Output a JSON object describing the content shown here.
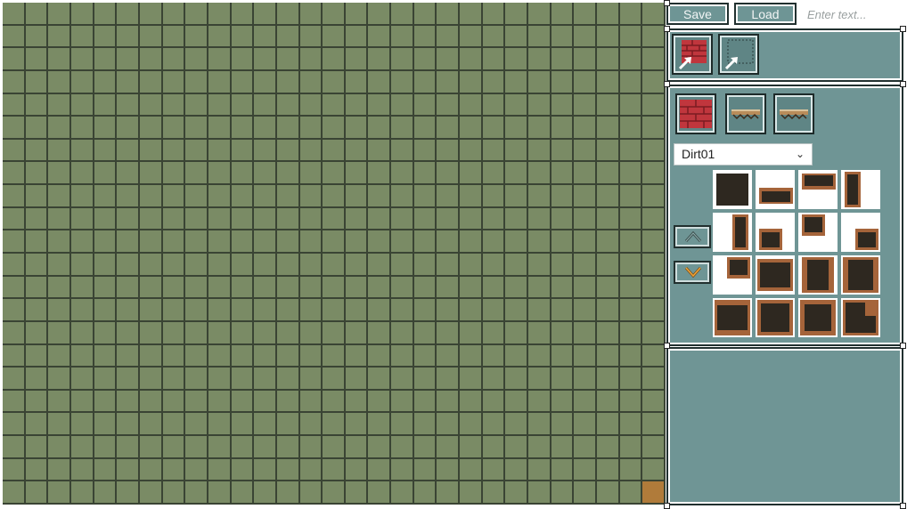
{
  "toolbar": {
    "save_label": "Save",
    "load_label": "Load",
    "text_placeholder": "Enter text...",
    "text_value": ""
  },
  "grid": {
    "columns": 29,
    "rows": 22,
    "colors": {
      "cell": "#7a8b65",
      "line": "#3a4434",
      "filled": "#b07b3a"
    },
    "filled_cells": [
      {
        "col": 28,
        "row": 21
      }
    ]
  },
  "brush_slots": [
    {
      "name": "brick-brush",
      "icon": "red-brick-icon"
    },
    {
      "name": "empty-brush",
      "icon": "dotted-square-icon"
    }
  ],
  "tileset_slots": [
    {
      "name": "brick-tileset",
      "icon": "red-brick-icon"
    },
    {
      "name": "platform-tileset-1",
      "icon": "platform-icon"
    },
    {
      "name": "platform-tileset-2",
      "icon": "platform-icon"
    }
  ],
  "tileset_dropdown": {
    "selected": "Dirt01"
  },
  "scroll_buttons": [
    {
      "name": "scroll-up",
      "icon": "chevron-up-icon"
    },
    {
      "name": "scroll-down",
      "icon": "chevron-down-icon"
    }
  ],
  "tiles": {
    "columns": 4,
    "items": [
      "dirt-solid",
      "dirt-bottom",
      "dirt-top",
      "dirt-right",
      "dirt-left",
      "dirt-corner-bl",
      "dirt-corner-tl",
      "dirt-corner-br",
      "dirt-corner-tr",
      "dirt-h-bar",
      "dirt-v-bar",
      "dirt-cross",
      "dirt-t-up",
      "dirt-t-down",
      "dirt-x",
      "dirt-l"
    ]
  },
  "colors": {
    "panel": "#6f9595",
    "panel_border": "#21302f",
    "dirt_dark": "#2e2820",
    "dirt_edge": "#a5643a",
    "brick": "#c0363d"
  }
}
